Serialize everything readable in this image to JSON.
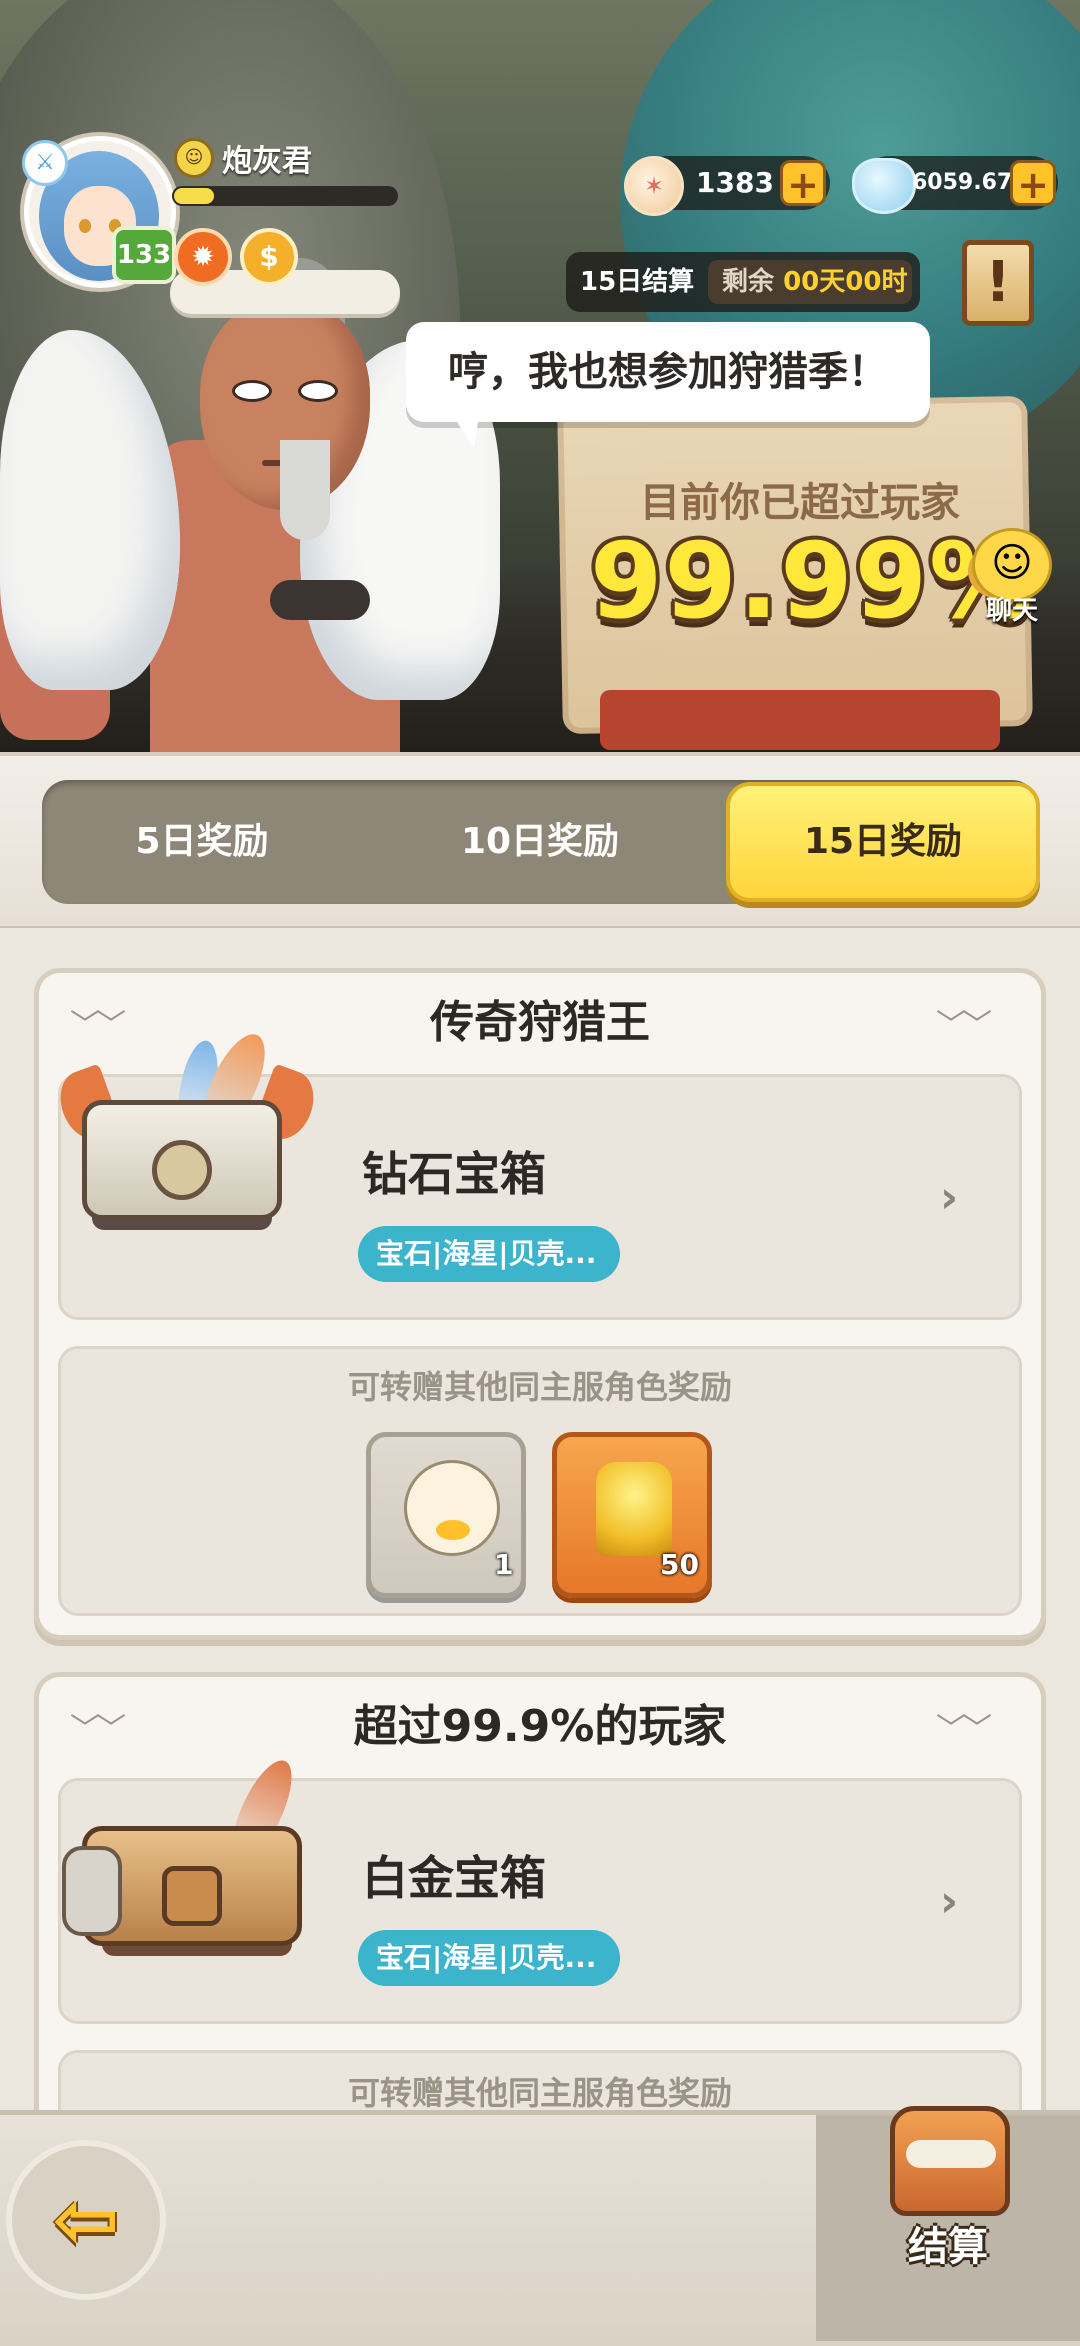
{
  "player": {
    "name": "炮灰君",
    "level": "133",
    "xp_progress": 0.18
  },
  "currency": {
    "shells": "1383",
    "diamonds": "6059.67M",
    "shell_icon": "shell-icon",
    "gem_icon": "gem-icon"
  },
  "settlement": {
    "label": "15日结算",
    "remaining_label": "剩余",
    "remaining_value": "00天00时"
  },
  "hero": {
    "speech": "哼，我也想参加狩猎季！",
    "banner_text": "目前你已超过玩家",
    "banner_percent": "99.99%"
  },
  "chat": {
    "label": "聊天"
  },
  "tabs": [
    {
      "label": "5日奖励",
      "active": false
    },
    {
      "label": "10日奖励",
      "active": false
    },
    {
      "label": "15日奖励",
      "active": true
    }
  ],
  "rewards": [
    {
      "title": "传奇狩猎王",
      "item_name": "钻石宝箱",
      "item_tag": "宝石|海星|贝壳...",
      "gift_label": "可转赠其他同主服角色奖励",
      "gifts": [
        {
          "icon": "chick-icon",
          "count": "1"
        },
        {
          "icon": "trophy-chest-icon",
          "count": "50"
        }
      ]
    },
    {
      "title": "超过99.9%的玩家",
      "item_name": "白金宝箱",
      "item_tag": "宝石|海星|贝壳...",
      "gift_label": "可转赠其他同主服角色奖励"
    }
  ],
  "footer": {
    "settle_label": "结算"
  },
  "colors": {
    "accent_yellow": "#ffd43a",
    "tag_cyan": "#3cb4cc",
    "level_green": "#55a83a"
  }
}
